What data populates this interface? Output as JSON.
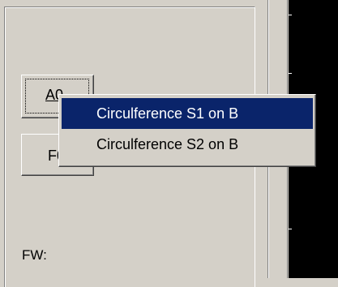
{
  "buttons": {
    "a_label": "A0",
    "f_label": "F0"
  },
  "fw_label": "FW:",
  "context_menu": {
    "items": [
      {
        "label": "Circulference S1 on B",
        "selected": true
      },
      {
        "label": "Circulference S2 on B",
        "selected": false
      }
    ]
  },
  "colors": {
    "face": "#d4d0c8",
    "highlight": "#0a246a",
    "display": "#000000"
  }
}
